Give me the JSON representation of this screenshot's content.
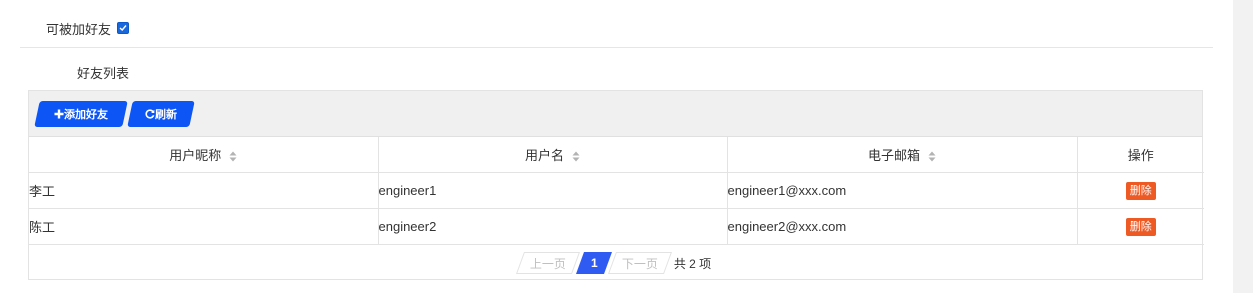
{
  "settings": {
    "allow_friend_label": "可被加好友",
    "allow_friend_checked": true
  },
  "section": {
    "title": "好友列表"
  },
  "toolbar": {
    "add_label": "添加好友",
    "refresh_label": "刷新",
    "accent_color": "#0d56f5"
  },
  "table": {
    "columns": [
      {
        "label": "用户昵称",
        "sortable": true
      },
      {
        "label": "用户名",
        "sortable": true
      },
      {
        "label": "电子邮箱",
        "sortable": true
      },
      {
        "label": "操作",
        "sortable": false
      }
    ],
    "rows": [
      {
        "nickname": "李工",
        "username": "engineer1",
        "email": "engineer1@xxx.com",
        "action": "删除"
      },
      {
        "nickname": "陈工",
        "username": "engineer2",
        "email": "engineer2@xxx.com",
        "action": "删除"
      }
    ],
    "delete_color": "#ee5a24"
  },
  "pagination": {
    "prev_label": "上一页",
    "current_page": "1",
    "next_label": "下一页",
    "total_text": "共 2 项"
  },
  "icons": {
    "add": "plus-icon",
    "refresh": "refresh-icon",
    "sort": "sort-icon",
    "checkbox": "check-icon"
  }
}
